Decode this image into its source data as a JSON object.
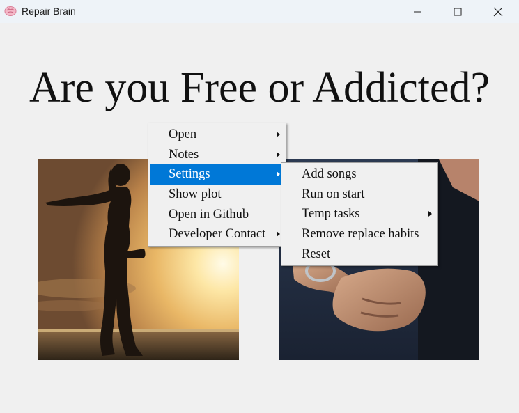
{
  "window": {
    "title": "Repair Brain",
    "icon": "brain-icon",
    "controls": [
      "minimize-icon",
      "maximize-icon",
      "close-icon"
    ]
  },
  "main": {
    "heading": "Are you Free or Addicted?",
    "images": [
      {
        "name": "free-photo",
        "description_icon": "woman-silhouette-sunset"
      },
      {
        "name": "addicted-photo",
        "description_icon": "handcuffed-hands"
      }
    ]
  },
  "context_menu": {
    "items": [
      {
        "label": "Open",
        "has_submenu": true
      },
      {
        "label": "Notes",
        "has_submenu": true
      },
      {
        "label": "Settings",
        "has_submenu": true,
        "highlighted": true
      },
      {
        "label": "Show plot",
        "has_submenu": false
      },
      {
        "label": "Open in Github",
        "has_submenu": false
      },
      {
        "label": "Developer Contact",
        "has_submenu": true
      }
    ]
  },
  "settings_submenu": {
    "items": [
      {
        "label": "Add songs",
        "has_submenu": false
      },
      {
        "label": "Run on start",
        "has_submenu": false
      },
      {
        "label": "Temp tasks",
        "has_submenu": true
      },
      {
        "label": "Remove replace habits",
        "has_submenu": false
      },
      {
        "label": "Reset",
        "has_submenu": false
      }
    ]
  },
  "colors": {
    "highlight": "#0078d7",
    "background": "#f0f0f0",
    "titlebar": "#eef3f8"
  }
}
